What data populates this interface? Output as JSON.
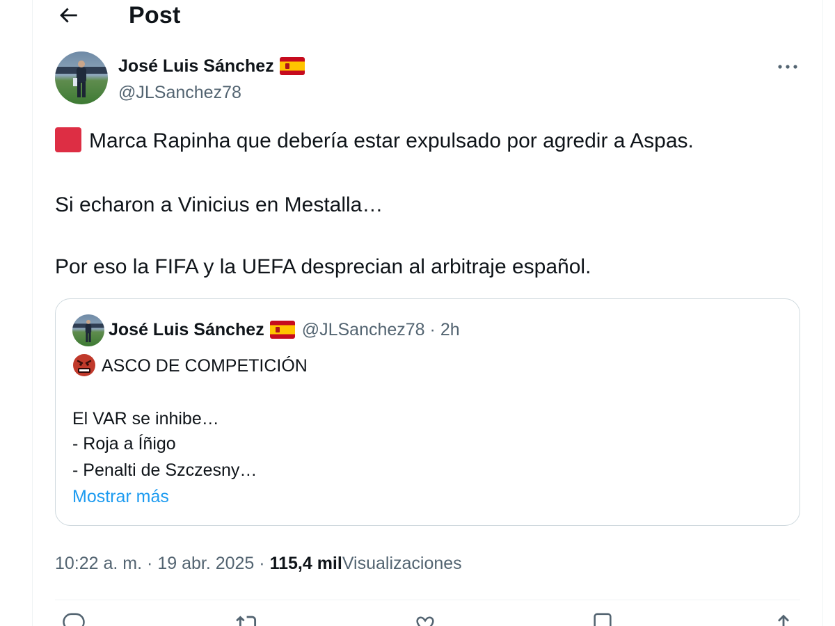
{
  "header": {
    "title": "Post",
    "back_icon": "arrow-left-icon"
  },
  "post": {
    "author": {
      "name": "José Luis Sánchez",
      "flag_icon": "spain-flag-icon",
      "handle": "@JLSanchez78"
    },
    "more_icon": "more-horizontal-icon",
    "text_lines": [
      "Marca Rapinha que debería estar expulsado por agredir a Aspas.",
      "Si echaron a Vinicius en Mestalla…",
      "Por eso la FIFA y la UEFA desprecian al arbitraje español."
    ],
    "lead_emoji": "red-square-icon",
    "quote": {
      "name": "José Luis Sánchez",
      "handle": "@JLSanchez78",
      "time": "2h",
      "lines": [
        "ASCO DE COMPETICIÓN",
        "El VAR se inhibe…",
        "- Roja a Íñigo",
        "- Penalti de Szczesny…"
      ],
      "emoji": "angry-face-icon",
      "show_more": "Mostrar más"
    },
    "time": "10:22 a. m.",
    "date": "19 abr. 2025",
    "views_count": "115,4 mil",
    "views_label": "Visualizaciones",
    "separator": "·"
  },
  "colors": {
    "text": "#0f1419",
    "secondary": "#536471",
    "link": "#1d9bf0",
    "border": "#cfd9de",
    "red_square": "#dd2e44"
  }
}
